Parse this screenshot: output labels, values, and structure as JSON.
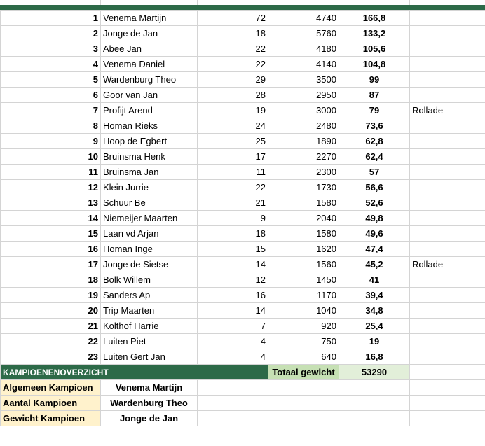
{
  "colors": {
    "header_band": "#2d6a48",
    "kampioen_band": "#2d6a48",
    "totaal_label_bg": "#c6e0b4",
    "totaal_value_bg": "#e2efd9",
    "champion_label_bg": "#fff2cc"
  },
  "rows": [
    {
      "rank": "1",
      "name": "Venema Martijn",
      "count": "72",
      "weight": "4740",
      "score": "166,8",
      "note": ""
    },
    {
      "rank": "2",
      "name": "Jonge de Jan",
      "count": "18",
      "weight": "5760",
      "score": "133,2",
      "note": ""
    },
    {
      "rank": "3",
      "name": "Abee Jan",
      "count": "22",
      "weight": "4180",
      "score": "105,6",
      "note": ""
    },
    {
      "rank": "4",
      "name": "Venema Daniel",
      "count": "22",
      "weight": "4140",
      "score": "104,8",
      "note": ""
    },
    {
      "rank": "5",
      "name": "Wardenburg Theo",
      "count": "29",
      "weight": "3500",
      "score": "99",
      "note": ""
    },
    {
      "rank": "6",
      "name": "Goor van Jan",
      "count": "28",
      "weight": "2950",
      "score": "87",
      "note": ""
    },
    {
      "rank": "7",
      "name": "Profijt Arend",
      "count": "19",
      "weight": "3000",
      "score": "79",
      "note": "Rollade"
    },
    {
      "rank": "8",
      "name": "Homan Rieks",
      "count": "24",
      "weight": "2480",
      "score": "73,6",
      "note": ""
    },
    {
      "rank": "9",
      "name": "Hoop de Egbert",
      "count": "25",
      "weight": "1890",
      "score": "62,8",
      "note": ""
    },
    {
      "rank": "10",
      "name": "Bruinsma Henk",
      "count": "17",
      "weight": "2270",
      "score": "62,4",
      "note": ""
    },
    {
      "rank": "11",
      "name": "Bruinsma Jan",
      "count": "11",
      "weight": "2300",
      "score": "57",
      "note": ""
    },
    {
      "rank": "12",
      "name": "Klein Jurrie",
      "count": "22",
      "weight": "1730",
      "score": "56,6",
      "note": ""
    },
    {
      "rank": "13",
      "name": "Schuur Be",
      "count": "21",
      "weight": "1580",
      "score": "52,6",
      "note": ""
    },
    {
      "rank": "14",
      "name": "Niemeijer Maarten",
      "count": "9",
      "weight": "2040",
      "score": "49,8",
      "note": ""
    },
    {
      "rank": "15",
      "name": "Laan vd Arjan",
      "count": "18",
      "weight": "1580",
      "score": "49,6",
      "note": ""
    },
    {
      "rank": "16",
      "name": "Homan Inge",
      "count": "15",
      "weight": "1620",
      "score": "47,4",
      "note": ""
    },
    {
      "rank": "17",
      "name": "Jonge de Sietse",
      "count": "14",
      "weight": "1560",
      "score": "45,2",
      "note": "Rollade"
    },
    {
      "rank": "18",
      "name": "Bolk Willem",
      "count": "12",
      "weight": "1450",
      "score": "41",
      "note": ""
    },
    {
      "rank": "19",
      "name": "Sanders Ap",
      "count": "16",
      "weight": "1170",
      "score": "39,4",
      "note": ""
    },
    {
      "rank": "20",
      "name": "Trip Maarten",
      "count": "14",
      "weight": "1040",
      "score": "34,8",
      "note": ""
    },
    {
      "rank": "21",
      "name": "Kolthof Harrie",
      "count": "7",
      "weight": "920",
      "score": "25,4",
      "note": ""
    },
    {
      "rank": "22",
      "name": "Luiten Piet",
      "count": "4",
      "weight": "750",
      "score": "19",
      "note": ""
    },
    {
      "rank": "23",
      "name": "Luiten Gert Jan",
      "count": "4",
      "weight": "640",
      "score": "16,8",
      "note": ""
    }
  ],
  "overview": {
    "title": "KAMPIOENENOVERZICHT",
    "total_label": "Totaal gewicht",
    "total_value": "53290",
    "champions": [
      {
        "label": "Algemeen Kampioen",
        "name": "Venema Martijn"
      },
      {
        "label": "Aantal Kampioen",
        "name": "Wardenburg Theo"
      },
      {
        "label": "Gewicht Kampioen",
        "name": "Jonge de Jan"
      }
    ]
  }
}
